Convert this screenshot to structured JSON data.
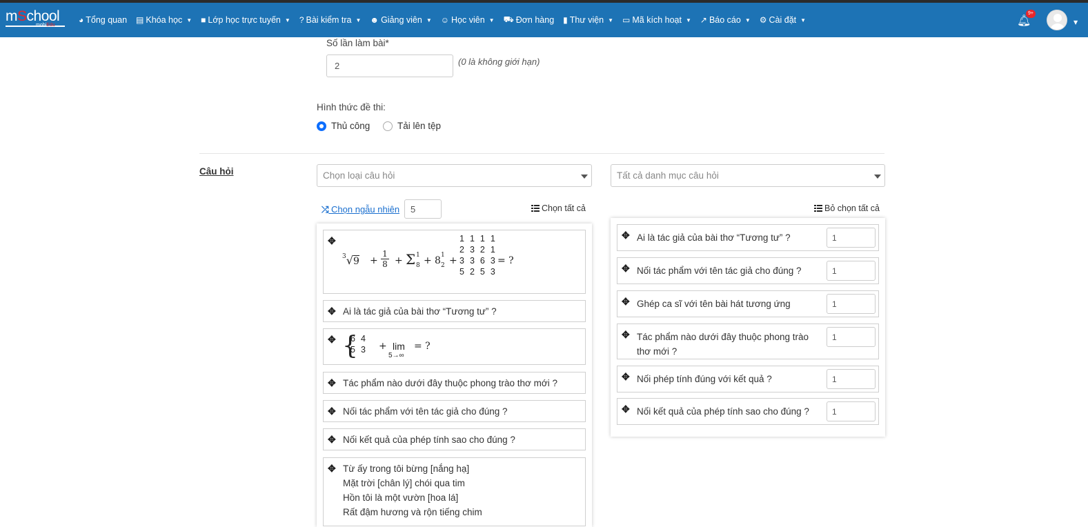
{
  "nav": {
    "logo_main": "m",
    "logo_s": "S",
    "logo_rest": "chool",
    "logo_sub": "mobi",
    "logo_sub2": "Edu",
    "items": [
      {
        "icon": "dashboard-icon",
        "glyph": "◕",
        "label": "Tổng quan",
        "caret": false
      },
      {
        "icon": "book-icon",
        "glyph": "▤",
        "label": "Khóa học",
        "caret": true
      },
      {
        "icon": "video-icon",
        "glyph": "■",
        "label": "Lớp học trực tuyến",
        "caret": true
      },
      {
        "icon": "question-icon",
        "glyph": "?",
        "label": "Bài kiểm tra",
        "caret": true
      },
      {
        "icon": "users-icon",
        "glyph": "☻",
        "label": "Giảng viên",
        "caret": true
      },
      {
        "icon": "user-icon",
        "glyph": "☺",
        "label": "Học viên",
        "caret": true
      },
      {
        "icon": "cart-icon",
        "glyph": "⛟",
        "label": "Đơn hàng",
        "caret": false
      },
      {
        "icon": "library-icon",
        "glyph": "▮",
        "label": "Thư viện",
        "caret": true
      },
      {
        "icon": "card-icon",
        "glyph": "▭",
        "label": "Mã kích hoạt",
        "caret": true
      },
      {
        "icon": "chart-icon",
        "glyph": "↗",
        "label": "Báo cáo",
        "caret": true
      },
      {
        "icon": "gears-icon",
        "glyph": "⚙",
        "label": "Cài đặt",
        "caret": true
      }
    ],
    "notification_count": "9+"
  },
  "form": {
    "attempts_label": "Số lần làm bài*",
    "attempts_value": "2",
    "attempts_hint": "(0 là không giới hạn)",
    "exam_type_label": "Hình thức đề thi:",
    "exam_type_options": [
      "Thủ công",
      "Tải lên tệp"
    ],
    "exam_type_selected": "Thủ công"
  },
  "questions": {
    "section_title": "Câu hỏi",
    "type_select_placeholder": "Chọn loại câu hỏi",
    "category_select_placeholder": "Tất cả danh mục câu hỏi",
    "random_link": " Chọn ngẫu nhiên",
    "random_count": "5",
    "select_all": "Chọn tất cả",
    "deselect_all": "Bỏ chọn tất cả",
    "available": {
      "q1_math": {
        "root_index": "3",
        "root_value": "9",
        "frac_num": "1",
        "frac_den": "8",
        "sum_sup": "1",
        "sum_sub": "8",
        "mixed_whole": "8",
        "mixed_num": "1",
        "mixed_den": "2",
        "matrix": [
          [
            "1",
            "1",
            "1",
            "1"
          ],
          [
            "2",
            "3",
            "2",
            "1"
          ],
          [
            "3",
            "3",
            "6",
            "3"
          ],
          [
            "5",
            "2",
            "5",
            "3"
          ]
        ],
        "tail": "= ?"
      },
      "q2": "Ai là tác giả của bài thơ “Tương tư” ?",
      "q3_math": {
        "system": [
          [
            "6",
            "4"
          ],
          [
            "5",
            "3"
          ]
        ],
        "plus": "+",
        "lim": "lim",
        "lim_sub": "5→∞",
        "tail": "= ?"
      },
      "q4": "Tác phẩm nào dưới đây thuộc phong trào thơ mới ?",
      "q5": "Nối tác phẩm với tên tác giả cho đúng ?",
      "q6": "Nối kết quả của phép tính sao cho đúng ?",
      "q7_lines": [
        "Từ ấy trong tôi bừng [nắng hạ]",
        "Mặt trời [chân lý] chói qua tim",
        "Hồn tôi là một vườn [hoa lá]",
        "Rất đậm hương và rộn tiếng chim"
      ]
    },
    "selected": [
      {
        "text": "Ai là tác giả của bài thơ “Tương tư” ?",
        "value": "1"
      },
      {
        "text": "Nối tác phẩm với tên tác giả cho đúng ?",
        "value": "1"
      },
      {
        "text": "Ghép ca sĩ với tên bài hát tương ứng",
        "value": "1"
      },
      {
        "text": "Tác phẩm nào dưới đây thuộc phong trào thơ mới ?",
        "value": "1"
      },
      {
        "text": "Nối phép tính đúng với kết quả ?",
        "value": "1"
      },
      {
        "text": "Nối kết quả của phép tính sao cho đúng ?",
        "value": "1"
      }
    ]
  }
}
